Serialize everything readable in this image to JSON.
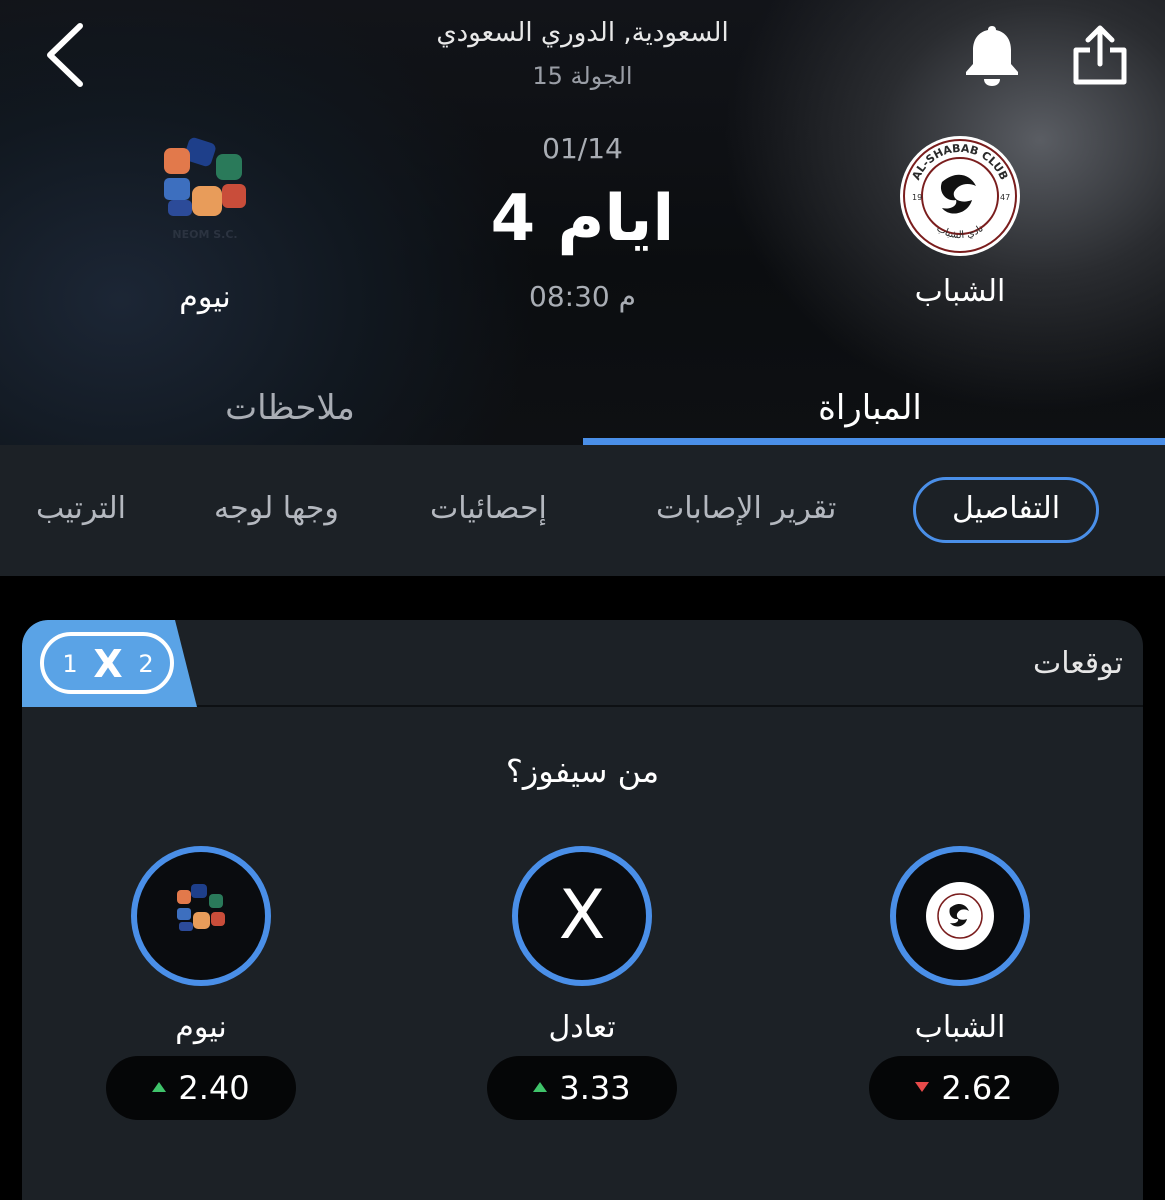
{
  "header": {
    "competition": "السعودية, الدوري السعودي",
    "round": "الجولة 15",
    "date": "01/14",
    "countdown": "4 ايام",
    "kickoff": "08:30 م",
    "home_team": {
      "name": "الشباب",
      "logo_text_top": "AL-SHABAB CLUB",
      "logo_text_bottom": "نادي الشباب",
      "logo_year_left": "19",
      "logo_year_right": "47"
    },
    "away_team": {
      "name": "نيوم",
      "logo_text": "NEOM S.C."
    }
  },
  "main_tabs": [
    {
      "label": "المباراة",
      "active": true
    },
    {
      "label": "ملاحظات",
      "active": false
    }
  ],
  "sub_tabs": [
    {
      "label": "التفاصيل",
      "active": true
    },
    {
      "label": "تقرير الإصابات",
      "active": false
    },
    {
      "label": "إحصائيات",
      "active": false
    },
    {
      "label": "وجها لوجه",
      "active": false
    },
    {
      "label": "الترتيب",
      "active": false
    }
  ],
  "predictions": {
    "title": "توقعات",
    "badge": {
      "one": "1",
      "x": "X",
      "two": "2"
    },
    "question": "من سيفوز؟",
    "options": [
      {
        "label": "الشباب",
        "odds": "2.62",
        "trend": "down"
      },
      {
        "label": "تعادل",
        "symbol": "X",
        "odds": "3.33",
        "trend": "up"
      },
      {
        "label": "نيوم",
        "odds": "2.40",
        "trend": "up"
      }
    ]
  },
  "colors": {
    "accent": "#4a8fe8",
    "up": "#3fc36a",
    "down": "#e84a4a",
    "panel": "#1c2126"
  }
}
